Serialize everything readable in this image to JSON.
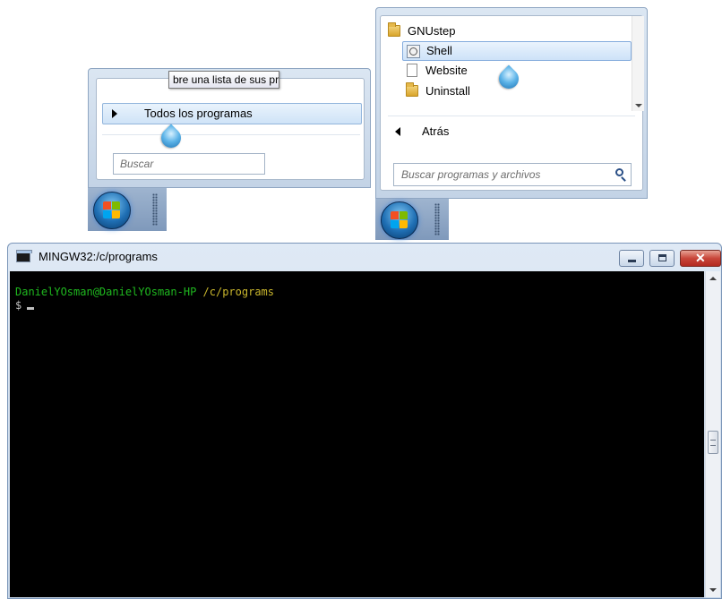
{
  "start_menu_1": {
    "all_programs_label": "Todos los programas",
    "search_placeholder": "Buscar",
    "tooltip_text": "bre una lista de sus programas."
  },
  "start_menu_2": {
    "items": [
      {
        "label": "GNUstep",
        "icon": "folder-icon"
      },
      {
        "label": "Shell",
        "icon": "shell-icon",
        "selected": true
      },
      {
        "label": "Website",
        "icon": "document-icon"
      },
      {
        "label": "Uninstall",
        "icon": "folder-icon"
      }
    ],
    "back_label": "Atrás",
    "search_placeholder": "Buscar programas y archivos"
  },
  "terminal": {
    "title": "MINGW32:/c/programs",
    "prompt_user": "DanielYOsman@DanielYOsman-HP",
    "prompt_path": "/c/programs",
    "prompt_symbol": "$"
  },
  "colors": {
    "prompt_user": "#1fb81f",
    "prompt_path": "#c9b62d",
    "terminal_bg": "#000000",
    "close_button": "#c8463a"
  }
}
